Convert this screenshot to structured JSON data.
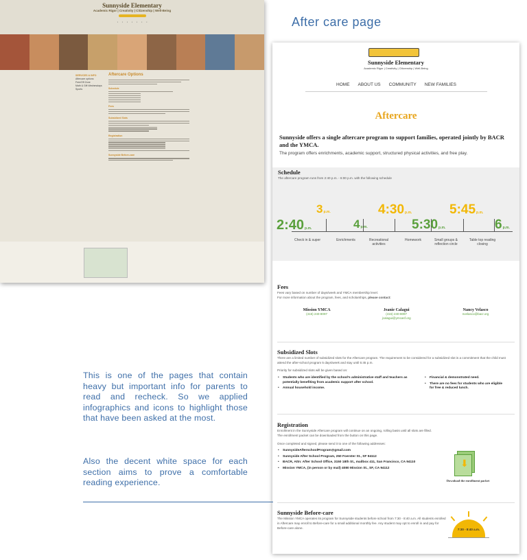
{
  "heading": "After care page",
  "description": {
    "paragraph1": "This is one of the pages that contain heavy but important info for parents to read and recheck. So we applied infographics and icons to highlight those that have been asked at the most.",
    "paragraph2": "Also the decent white space for each section aims to prove a comfortable reading experience."
  },
  "old_page": {
    "school_name": "Sunnyside Elementary",
    "tagline": "Academic Rigor | Creativity | Citizenship | Well-Being",
    "page_title": "Aftercare Options",
    "sidebar_header": "SERVICES & INFO",
    "sidebar_items": [
      "Aftercare options",
      "Free/Off Zone",
      "Math & Gift Wednesdays",
      "Sports"
    ],
    "sections": [
      "Schedule",
      "Fees",
      "Subsidized Slots",
      "Registration",
      "Sunnyside Before-care"
    ]
  },
  "new_page": {
    "logo_title": "Sunnyside Elementary",
    "logo_subtitle": "Academic Rigor | Creativity | Citizenship | Well-Being",
    "nav": [
      "HOME",
      "ABOUT US",
      "COMMUNITY",
      "NEW FAMILIES"
    ],
    "title": "Aftercare",
    "intro_lead": "Sunnyside offers a single aftercare program to support families, operated jointly by BACR and the YMCA.",
    "intro_text": "The program offers enrichments, academic support, structured physical activities, and free play.",
    "schedule": {
      "heading": "Schedule",
      "text": "The aftercare program runs from 2:40 p.m. - 6:00 p.m. with the following schedule",
      "pm": "p.m.",
      "times": [
        {
          "label": "2:40",
          "color": "#5aa03c"
        },
        {
          "label": "3",
          "color": "#f2b705"
        },
        {
          "label": "4",
          "color": "#5aa03c"
        },
        {
          "label": "4:30",
          "color": "#f2b705"
        },
        {
          "label": "5:30",
          "color": "#5aa03c"
        },
        {
          "label": "5:45",
          "color": "#f2b705"
        },
        {
          "label": "6",
          "color": "#5aa03c"
        }
      ],
      "activities": [
        "Check in & super",
        "Enrichments",
        "Recreational activities",
        "Homework",
        "Small groups & reflection circle",
        "Table top reading closing"
      ]
    },
    "fees": {
      "heading": "Fees",
      "line1": "Fees vary based on number of days/week and YMCA membership level.",
      "line2_prefix": "For more information about the program, fees, and scholarships, ",
      "line2_bold": "please contact:",
      "contacts": [
        {
          "name": "Mission YMCA",
          "info1": "(415) 240-8097",
          "info2": ""
        },
        {
          "name": "Jeanie Calagui",
          "info1": "(415) 240-8097",
          "info2": "jcalagui@ymcasf.org"
        },
        {
          "name": "Nancy Velasco",
          "info1": "nvelasco@bacr.org",
          "info2": ""
        }
      ]
    },
    "subsidized": {
      "heading": "Subsidized Slots",
      "text": "There are a limited number of subsidized slots for the Aftercare program. The requirement to be considered for a subsidized slot is a commitment that the child must attend the after-school program 5 days/week and stay until 5:45 p.m.",
      "priority": "Priority for subsidized slots will be given based on:",
      "bullets_left": [
        "Students who are identified by the school's administrative staff and teachers as potentially benefiting from academic support after school.",
        "Annual household income."
      ],
      "bullets_right": [
        "Financial & demonstrated need.",
        "There are no fees for students who are eligible for free & reduced lunch."
      ]
    },
    "registration": {
      "heading": "Registration",
      "text1": "Enrollment in the Sunnyside Aftercare program will continue on an ongoing, rolling basis until all slots are filled.",
      "text2": "The enrollment packet can be downloaded from the button on this page.",
      "text3": "Once completed and signed, please send it to one of the following addresses:",
      "addresses": [
        "SunnysideAfterschoolProgram@gmail.com",
        "Sunnyside After School Program, 250 Foerster St., SF 94112",
        "BACR, Attn: After School Office, 3150 18th St., mailbox 411, San Francisco, CA 94110",
        "Mission YMCA, (in person or by mail) 4080 Mission St., SF, CA 94112"
      ],
      "download_label": "Download the enrollment packet"
    },
    "before_care": {
      "heading": "Sunnyside Before-care",
      "text": "The Mission YMCA operates its program for Sunnyside students before school from 7:30 - 8:40 a.m. All students enrolled in Aftercare may enroll to Before-care for a small additional monthly fee. Any student may opt to enroll in and pay for Before-care alone.",
      "time_badge": "7:30 - 8:40 a.m."
    }
  }
}
